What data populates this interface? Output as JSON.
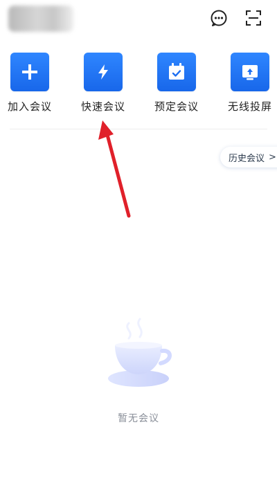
{
  "header": {
    "chat_icon": "chat-bubble-icon",
    "scan_icon": "scan-icon"
  },
  "actions": [
    {
      "label": "加入会议",
      "icon": "plus-icon"
    },
    {
      "label": "快速会议",
      "icon": "lightning-icon"
    },
    {
      "label": "预定会议",
      "icon": "calendar-check-icon"
    },
    {
      "label": "无线投屏",
      "icon": "screen-cast-icon"
    }
  ],
  "history": {
    "label": "历史会议",
    "chevron": ">"
  },
  "empty_state": {
    "text": "暂无会议",
    "icon": "coffee-cup-icon"
  },
  "colors": {
    "accent": "#1E6FF1",
    "annotation": "#E0202A"
  }
}
